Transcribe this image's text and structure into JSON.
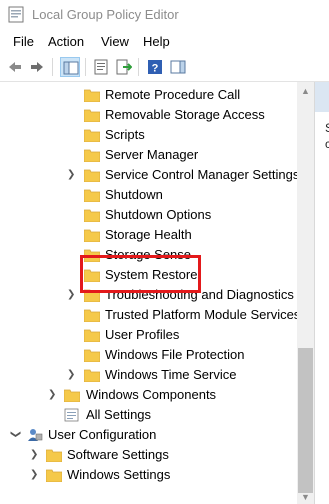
{
  "window": {
    "title": "Local Group Policy Editor"
  },
  "menu": {
    "items": [
      "File",
      "Action",
      "View",
      "Help"
    ]
  },
  "toolbar": {
    "buttons": [
      "back-icon",
      "forward-icon",
      "show-hide-tree-icon",
      "properties-icon",
      "export-list-icon",
      "help-icon",
      "show-hide-action-pane-icon"
    ]
  },
  "tree": {
    "items": [
      {
        "label": "Remote Procedure Call"
      },
      {
        "label": "Removable Storage Access"
      },
      {
        "label": "Scripts"
      },
      {
        "label": "Server Manager"
      },
      {
        "label": "Service Control Manager Settings"
      },
      {
        "label": "Shutdown"
      },
      {
        "label": "Shutdown Options"
      },
      {
        "label": "Storage Health"
      },
      {
        "label": "Storage Sense"
      },
      {
        "label": "System Restore"
      },
      {
        "label": "Troubleshooting and Diagnostics"
      },
      {
        "label": "Trusted Platform Module Services"
      },
      {
        "label": "User Profiles"
      },
      {
        "label": "Windows File Protection"
      },
      {
        "label": "Windows Time Service"
      },
      {
        "label": "Windows Components"
      },
      {
        "label": "All Settings"
      },
      {
        "label": "User Configuration"
      },
      {
        "label": "Software Settings"
      },
      {
        "label": "Windows Settings"
      }
    ]
  },
  "right_pane": {
    "text_fragment_1": "S",
    "text_fragment_2": "c"
  },
  "colors": {
    "highlight": "#e3191b",
    "folder": "#f5c94a",
    "scroll_thumb": "#c2c2c2"
  }
}
